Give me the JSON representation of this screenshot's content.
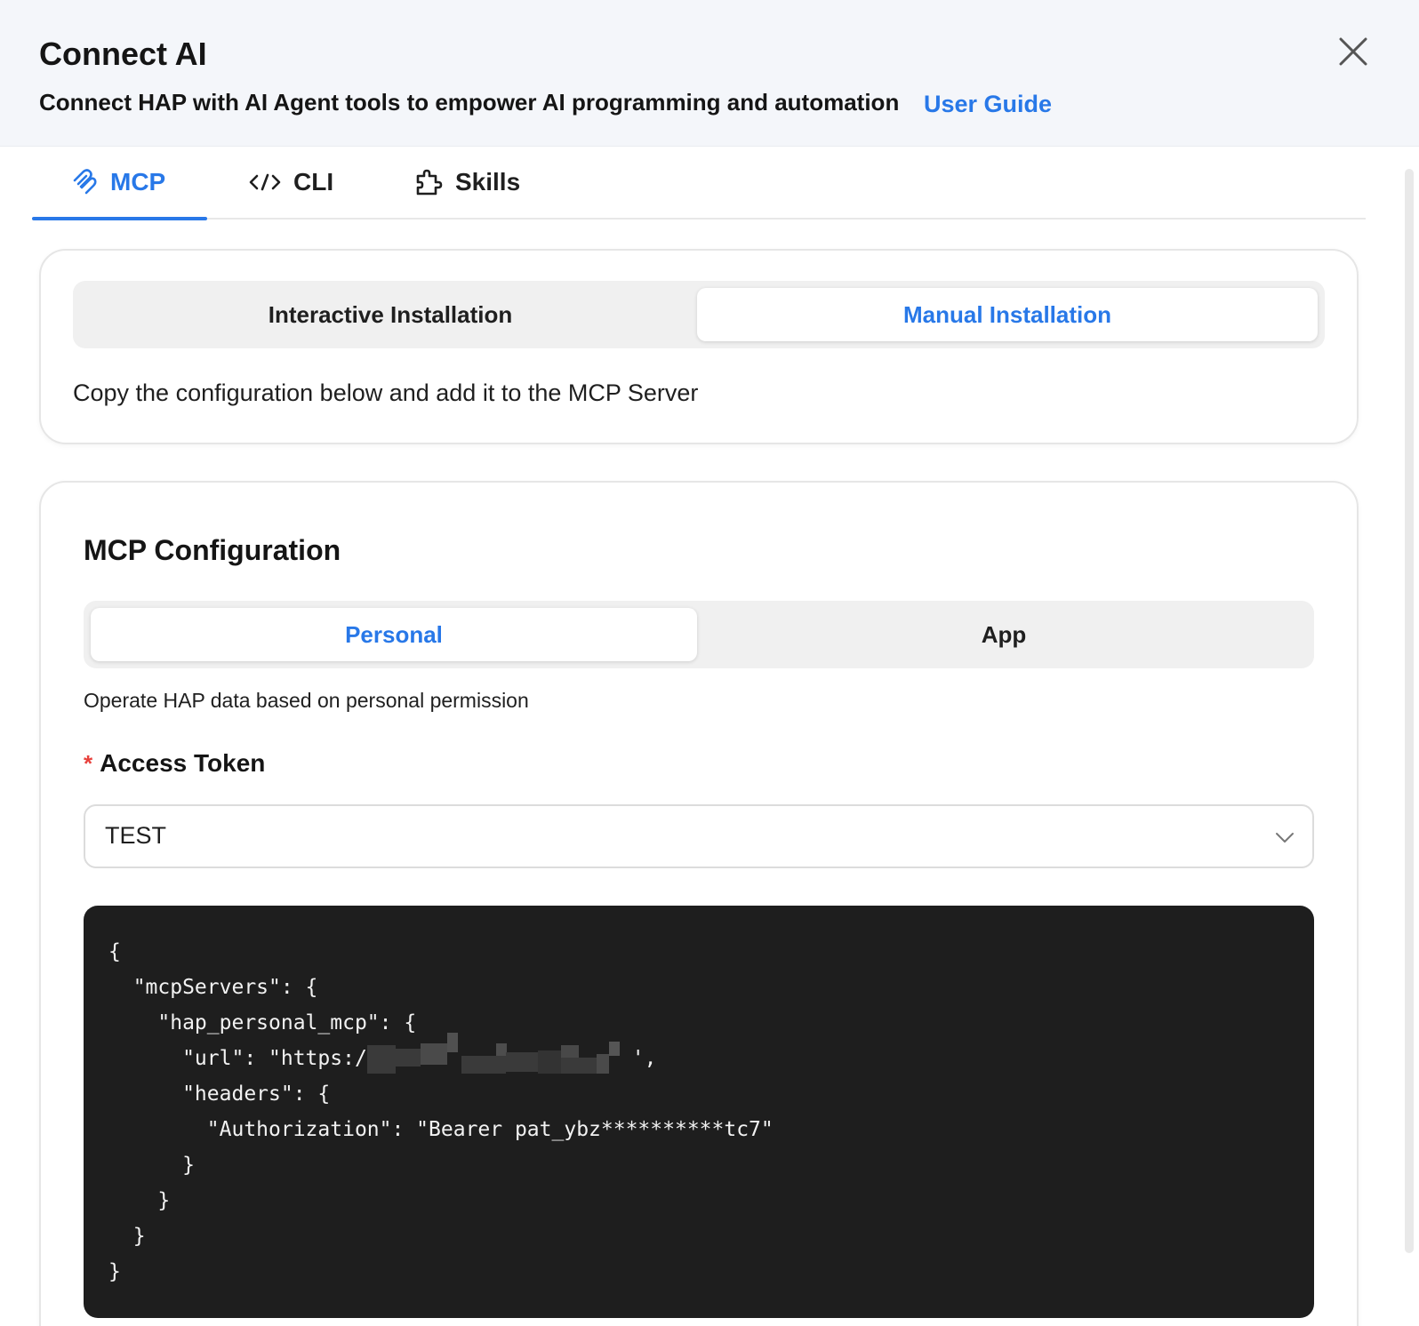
{
  "header": {
    "title": "Connect AI",
    "subtitle": "Connect HAP with AI Agent tools to empower AI programming and automation",
    "guide_link": "User Guide"
  },
  "tabs": [
    {
      "label": "MCP",
      "icon": "mcp-icon",
      "active": true
    },
    {
      "label": "CLI",
      "icon": "code-icon",
      "active": false
    },
    {
      "label": "Skills",
      "icon": "puzzle-icon",
      "active": false
    }
  ],
  "install": {
    "options": [
      "Interactive Installation",
      "Manual Installation"
    ],
    "selected": "Manual Installation",
    "description": "Copy the configuration below and add it to the MCP Server"
  },
  "config": {
    "title": "MCP Configuration",
    "scope_options": [
      "Personal",
      "App"
    ],
    "selected_scope": "Personal",
    "scope_description": "Operate HAP data based on personal permission",
    "token_label": "Access Token",
    "token_required_mark": "*",
    "token_value": "TEST",
    "code_lines": [
      "{",
      "  \"mcpServers\": {",
      "    \"hap_personal_mcp\": {",
      "      \"url\": \"https:/",
      "      \"headers\": {",
      "        \"Authorization\": \"Bearer pat_ybz**********tc7\"",
      "      }",
      "    }",
      "  }",
      "}"
    ],
    "url_suffix": "',"
  },
  "colors": {
    "accent": "#2878e8",
    "header_bg": "#f4f6fa",
    "code_bg": "#1e1e1e",
    "required": "#e8413c"
  }
}
